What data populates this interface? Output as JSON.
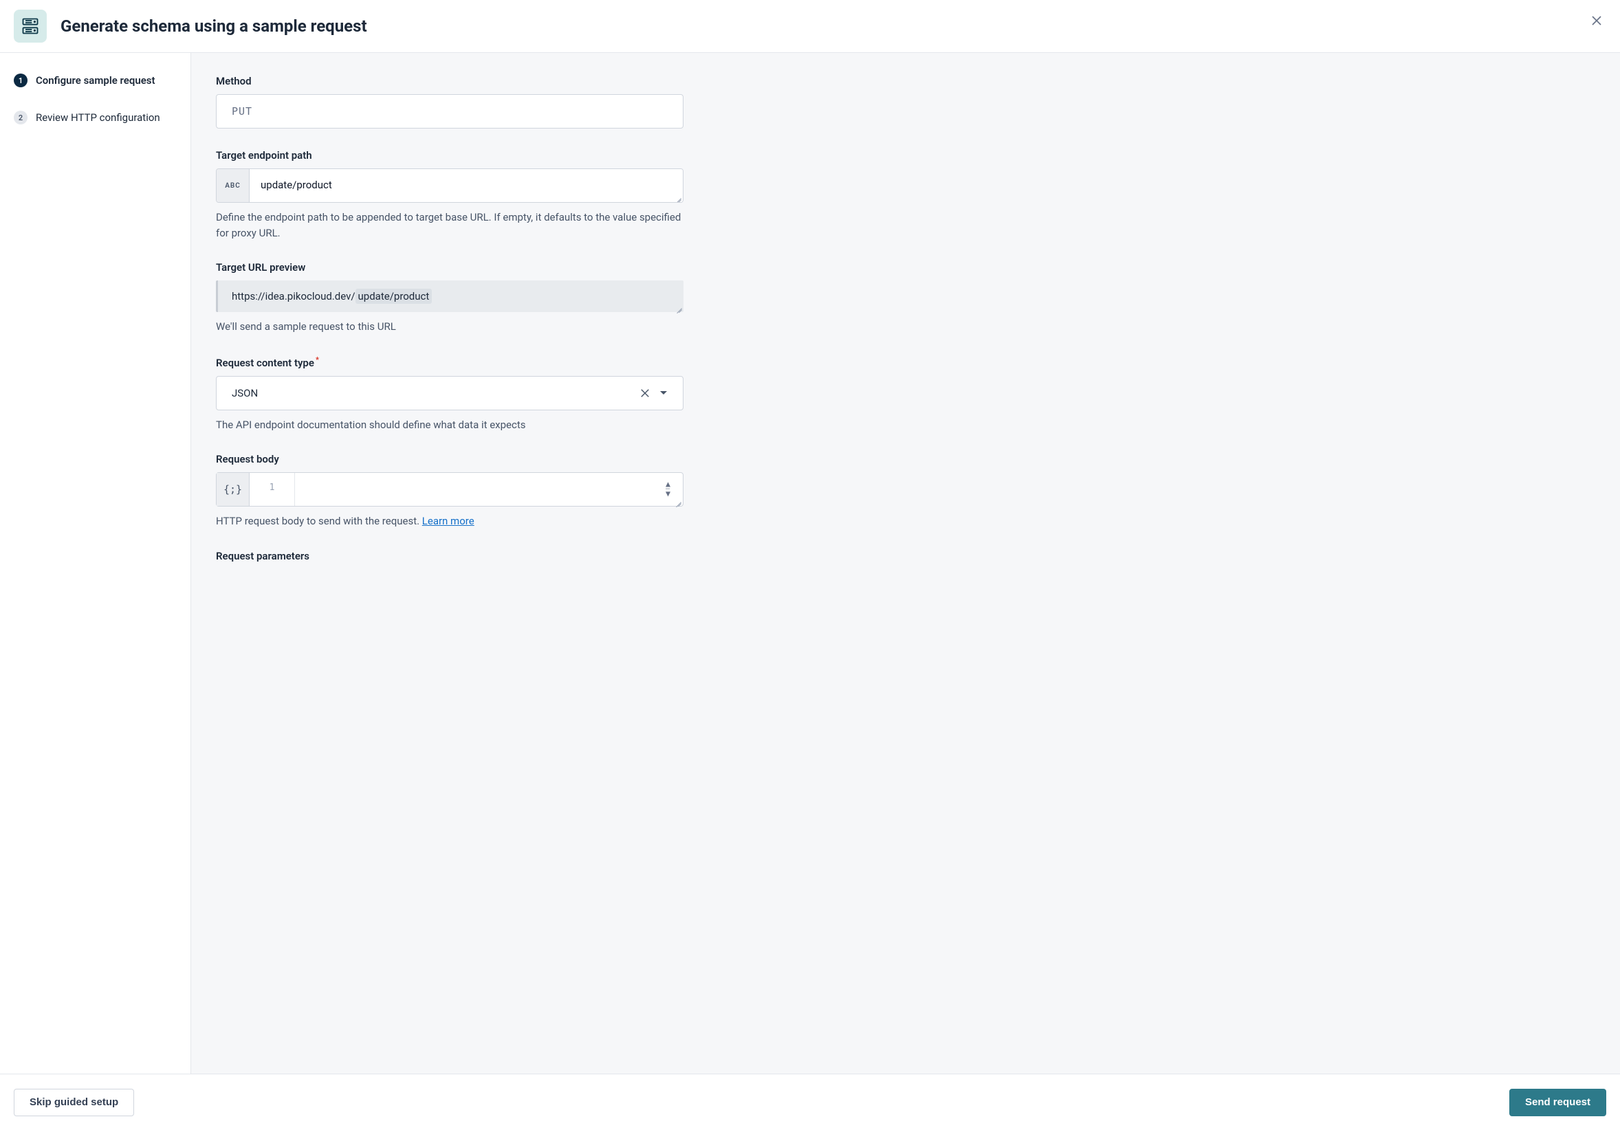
{
  "header": {
    "title": "Generate schema using a sample request"
  },
  "sidebar": {
    "steps": [
      {
        "num": "1",
        "label": "Configure sample request",
        "active": true
      },
      {
        "num": "2",
        "label": "Review HTTP configuration",
        "active": false
      }
    ]
  },
  "form": {
    "method": {
      "label": "Method",
      "value": "PUT"
    },
    "endpoint": {
      "label": "Target endpoint path",
      "addon": "ABC",
      "value": "update/product",
      "help": "Define the endpoint path to be appended to target base URL. If empty, it defaults to the value specified for proxy URL."
    },
    "url_preview": {
      "label": "Target URL preview",
      "base": "https://idea.pikocloud.dev/",
      "path": "update/product",
      "help": "We'll send a sample request to this URL"
    },
    "content_type": {
      "label": "Request content type",
      "required": true,
      "value": "JSON",
      "help": "The API endpoint documentation should define what data it expects"
    },
    "body": {
      "label": "Request body",
      "addon": "{;}",
      "line_number": "1",
      "help_prefix": "HTTP request body to send with the request. ",
      "learn_more": "Learn more"
    },
    "params": {
      "label": "Request parameters"
    }
  },
  "footer": {
    "skip": "Skip guided setup",
    "send": "Send request"
  }
}
